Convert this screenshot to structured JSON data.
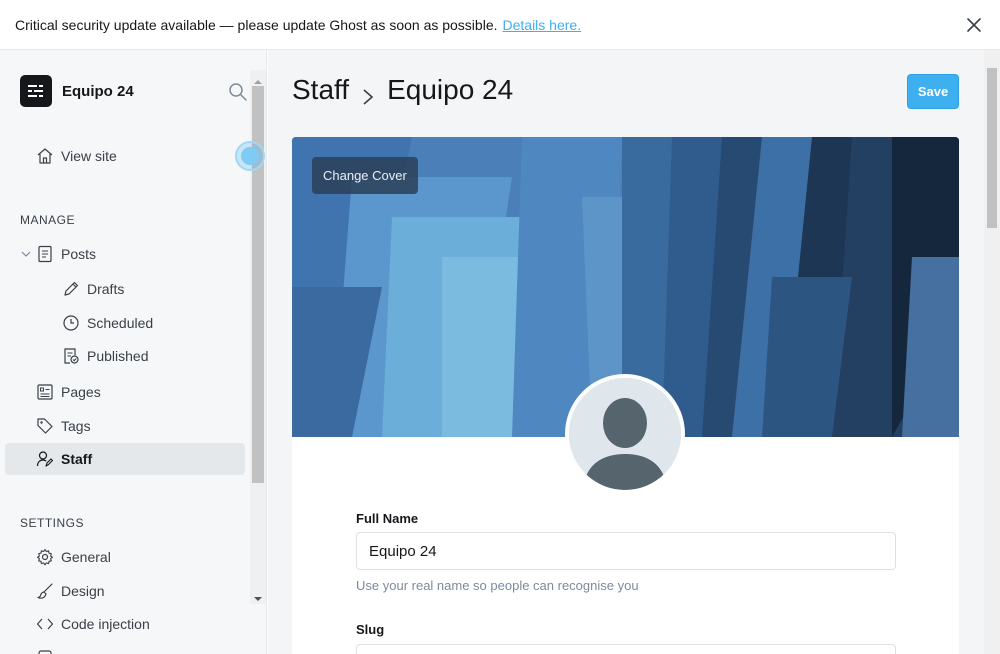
{
  "alert": {
    "message": "Critical security update available — please update Ghost as soon as possible.",
    "link_text": "Details here."
  },
  "sidebar": {
    "brand_name": "Equipo 24",
    "view_site": "View site",
    "manage_title": "MANAGE",
    "manage_items": {
      "posts": "Posts",
      "drafts": "Drafts",
      "scheduled": "Scheduled",
      "published": "Published",
      "pages": "Pages",
      "tags": "Tags",
      "staff": "Staff"
    },
    "settings_title": "SETTINGS",
    "settings_items": {
      "general": "General",
      "design": "Design",
      "code_injection": "Code injection"
    }
  },
  "header": {
    "crumb_parent": "Staff",
    "crumb_current": "Equipo 24",
    "save_label": "Save"
  },
  "profile": {
    "change_cover_label": "Change Cover",
    "full_name_label": "Full Name",
    "full_name_value": "Equipo 24",
    "full_name_hint": "Use your real name so people can recognise you",
    "slug_label": "Slug"
  },
  "colors": {
    "accent": "#3eb0ef",
    "sidebar_bg": "#f6f7f8",
    "main_bg": "#f4f5f7",
    "text": "#15171a"
  }
}
